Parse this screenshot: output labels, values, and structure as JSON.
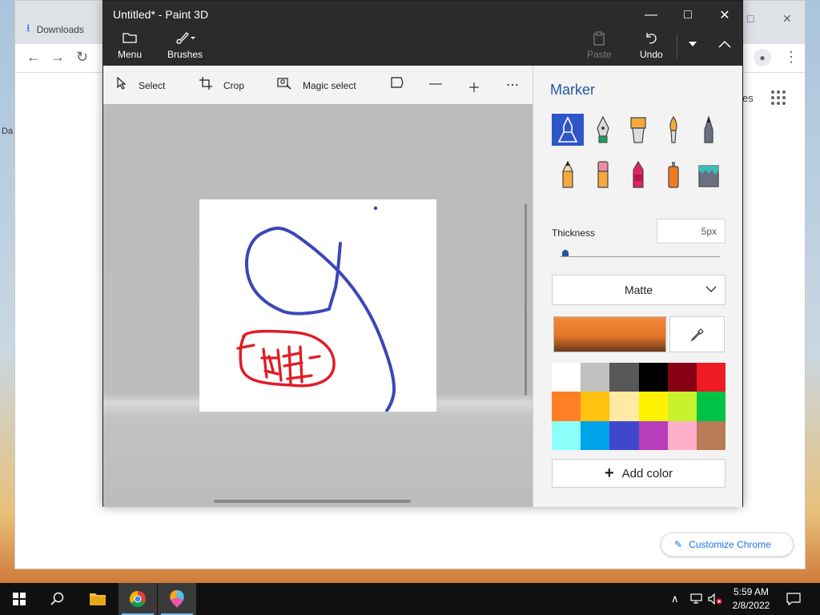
{
  "chrome": {
    "tab_label": "Downloads",
    "side_text": "Da",
    "partial_link": "es",
    "customize_label": "Customize Chrome"
  },
  "paint": {
    "title": "Untitled* - Paint 3D",
    "ribbon": {
      "menu": "Menu",
      "brushes": "Brushes",
      "paste": "Paste",
      "undo": "Undo"
    },
    "toolbar": {
      "select": "Select",
      "crop": "Crop",
      "magic_select": "Magic select"
    },
    "panel": {
      "title": "Marker",
      "brushes": [
        "marker",
        "calligraphy-pen",
        "oil-brush",
        "watercolor",
        "pixel-pen",
        "pencil",
        "eraser",
        "crayon",
        "spray-can",
        "fill"
      ],
      "selected_brush": "marker",
      "thickness_label": "Thickness",
      "thickness_value": "5px",
      "thickness_level": 0.02,
      "finish": "Matte",
      "current_color": "#e27528",
      "palette": [
        "#ffffff",
        "#c0c0c0",
        "#585858",
        "#000000",
        "#880015",
        "#ed1c24",
        "#ff7f27",
        "#ffc20e",
        "#ffe9a3",
        "#fff200",
        "#c6f12c",
        "#00c244",
        "#8cfffb",
        "#00a2e8",
        "#3f48cc",
        "#b83dba",
        "#ffaec9",
        "#b97a57"
      ],
      "add_color_label": "Add color"
    }
  },
  "taskbar": {
    "time": "5:59 AM",
    "date": "2/8/2022"
  }
}
